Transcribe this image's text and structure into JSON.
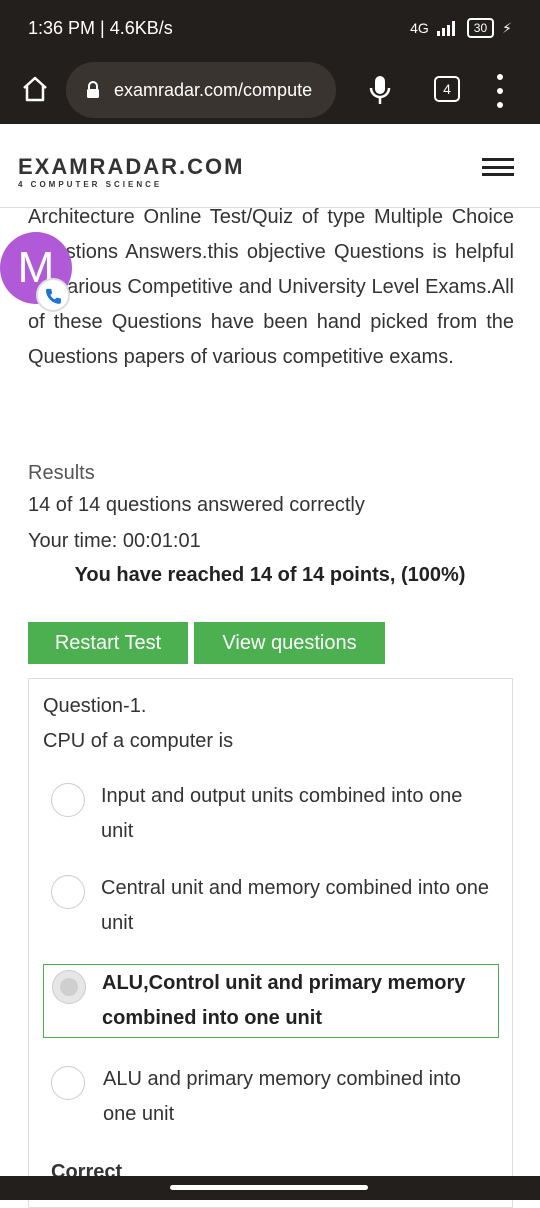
{
  "status_bar": {
    "time": "1:36 PM | 4.6KB/s",
    "network": "4G",
    "battery": "30"
  },
  "browser": {
    "url": "examradar.com/compute",
    "tab_count": "4"
  },
  "site": {
    "brand": "EXAMRADAR.COM",
    "tagline": "4 COMPUTER SCIENCE"
  },
  "intro": {
    "text": "Architecture Online Test/Quiz of type Multiple Choice Questions Answers.this objective Questions is helpful for various Competitive and University Level Exams.All of these Questions have been hand picked from the Questions papers of various competitive exams."
  },
  "avatar": {
    "letter": "M"
  },
  "results": {
    "title": "Results",
    "answered": "14 of 14 questions answered correctly",
    "time": "Your time: 00:01:01",
    "score": "You have reached 14 of 14 points, (100%)"
  },
  "buttons": {
    "restart": "Restart Test",
    "view": "View questions"
  },
  "question": {
    "number": "Question-1.",
    "text": "CPU of a computer is",
    "options": [
      {
        "label": "Input and output units combined into one unit"
      },
      {
        "label": "Central unit and memory combined into one unit"
      },
      {
        "label": "ALU,Control unit and primary memory combined into one unit"
      },
      {
        "label": "ALU and primary memory combined into one unit"
      }
    ],
    "selected_index": 2,
    "result_label": "Correct"
  },
  "colors": {
    "accent": "#4caf50",
    "bar": "#231f1c",
    "avatar": "#b05ad8"
  }
}
